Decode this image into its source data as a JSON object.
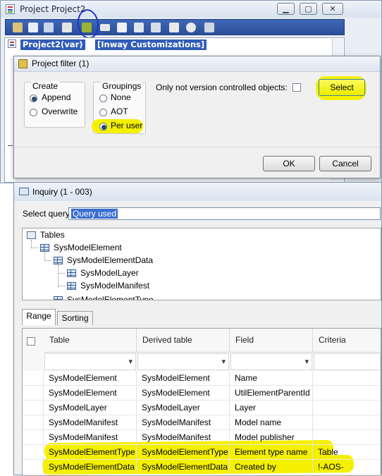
{
  "project_window": {
    "title": "Project Project2",
    "tree_root": "Project2(var)",
    "tree_root_suffix": "[Inway Customizations]"
  },
  "filter_dialog": {
    "title": "Project filter (1)",
    "create": {
      "label": "Create",
      "options": [
        "Append",
        "Overwrite"
      ],
      "selected": "Append"
    },
    "groupings": {
      "label": "Groupings",
      "options": [
        "None",
        "AOT",
        "Per user"
      ],
      "selected": "Per user"
    },
    "only_not_version_label": "Only not version controlled objects:",
    "select_button": "Select",
    "ok_button": "OK",
    "cancel_button": "Cancel"
  },
  "inquiry_window": {
    "title": "Inquiry (1 - 003)",
    "select_query_label": "Select query:",
    "select_query_value": "Query used",
    "tree": {
      "root": "Tables",
      "items": [
        "SysModelElement",
        "SysModelElementData",
        "SysModelLayer",
        "SysModelManifest",
        "SysModelElementType"
      ]
    },
    "tabs": [
      "Range",
      "Sorting"
    ],
    "active_tab": "Range",
    "columns": [
      "Table",
      "Derived table",
      "Field",
      "Criteria"
    ],
    "rows": [
      [
        "SysModelElement",
        "SysModelElement",
        "Name",
        ""
      ],
      [
        "SysModelElement",
        "SysModelElement",
        "UtilElementParentId",
        ""
      ],
      [
        "SysModelLayer",
        "SysModelLayer",
        "Layer",
        ""
      ],
      [
        "SysModelManifest",
        "SysModelManifest",
        "Model name",
        ""
      ],
      [
        "SysModelManifest",
        "SysModelManifest",
        "Model publisher",
        ""
      ],
      [
        "SysModelElementType",
        "SysModelElementType",
        "Element type name",
        "Table"
      ],
      [
        "SysModelElementData",
        "SysModelElementData",
        "Created by",
        "!-AOS-"
      ]
    ],
    "highlighted_rows": [
      5,
      6
    ]
  },
  "colors": {
    "highlight": "#f4f000",
    "toolbar": "#2f569f",
    "selection": "#2f5bb7",
    "annotation_circle": "#1a33c8"
  },
  "icons": [
    "project-icon",
    "minimize-icon",
    "maximize-icon",
    "close-icon",
    "filter-icon",
    "inquiry-icon",
    "table-icon",
    "dropdown-arrow-icon"
  ]
}
